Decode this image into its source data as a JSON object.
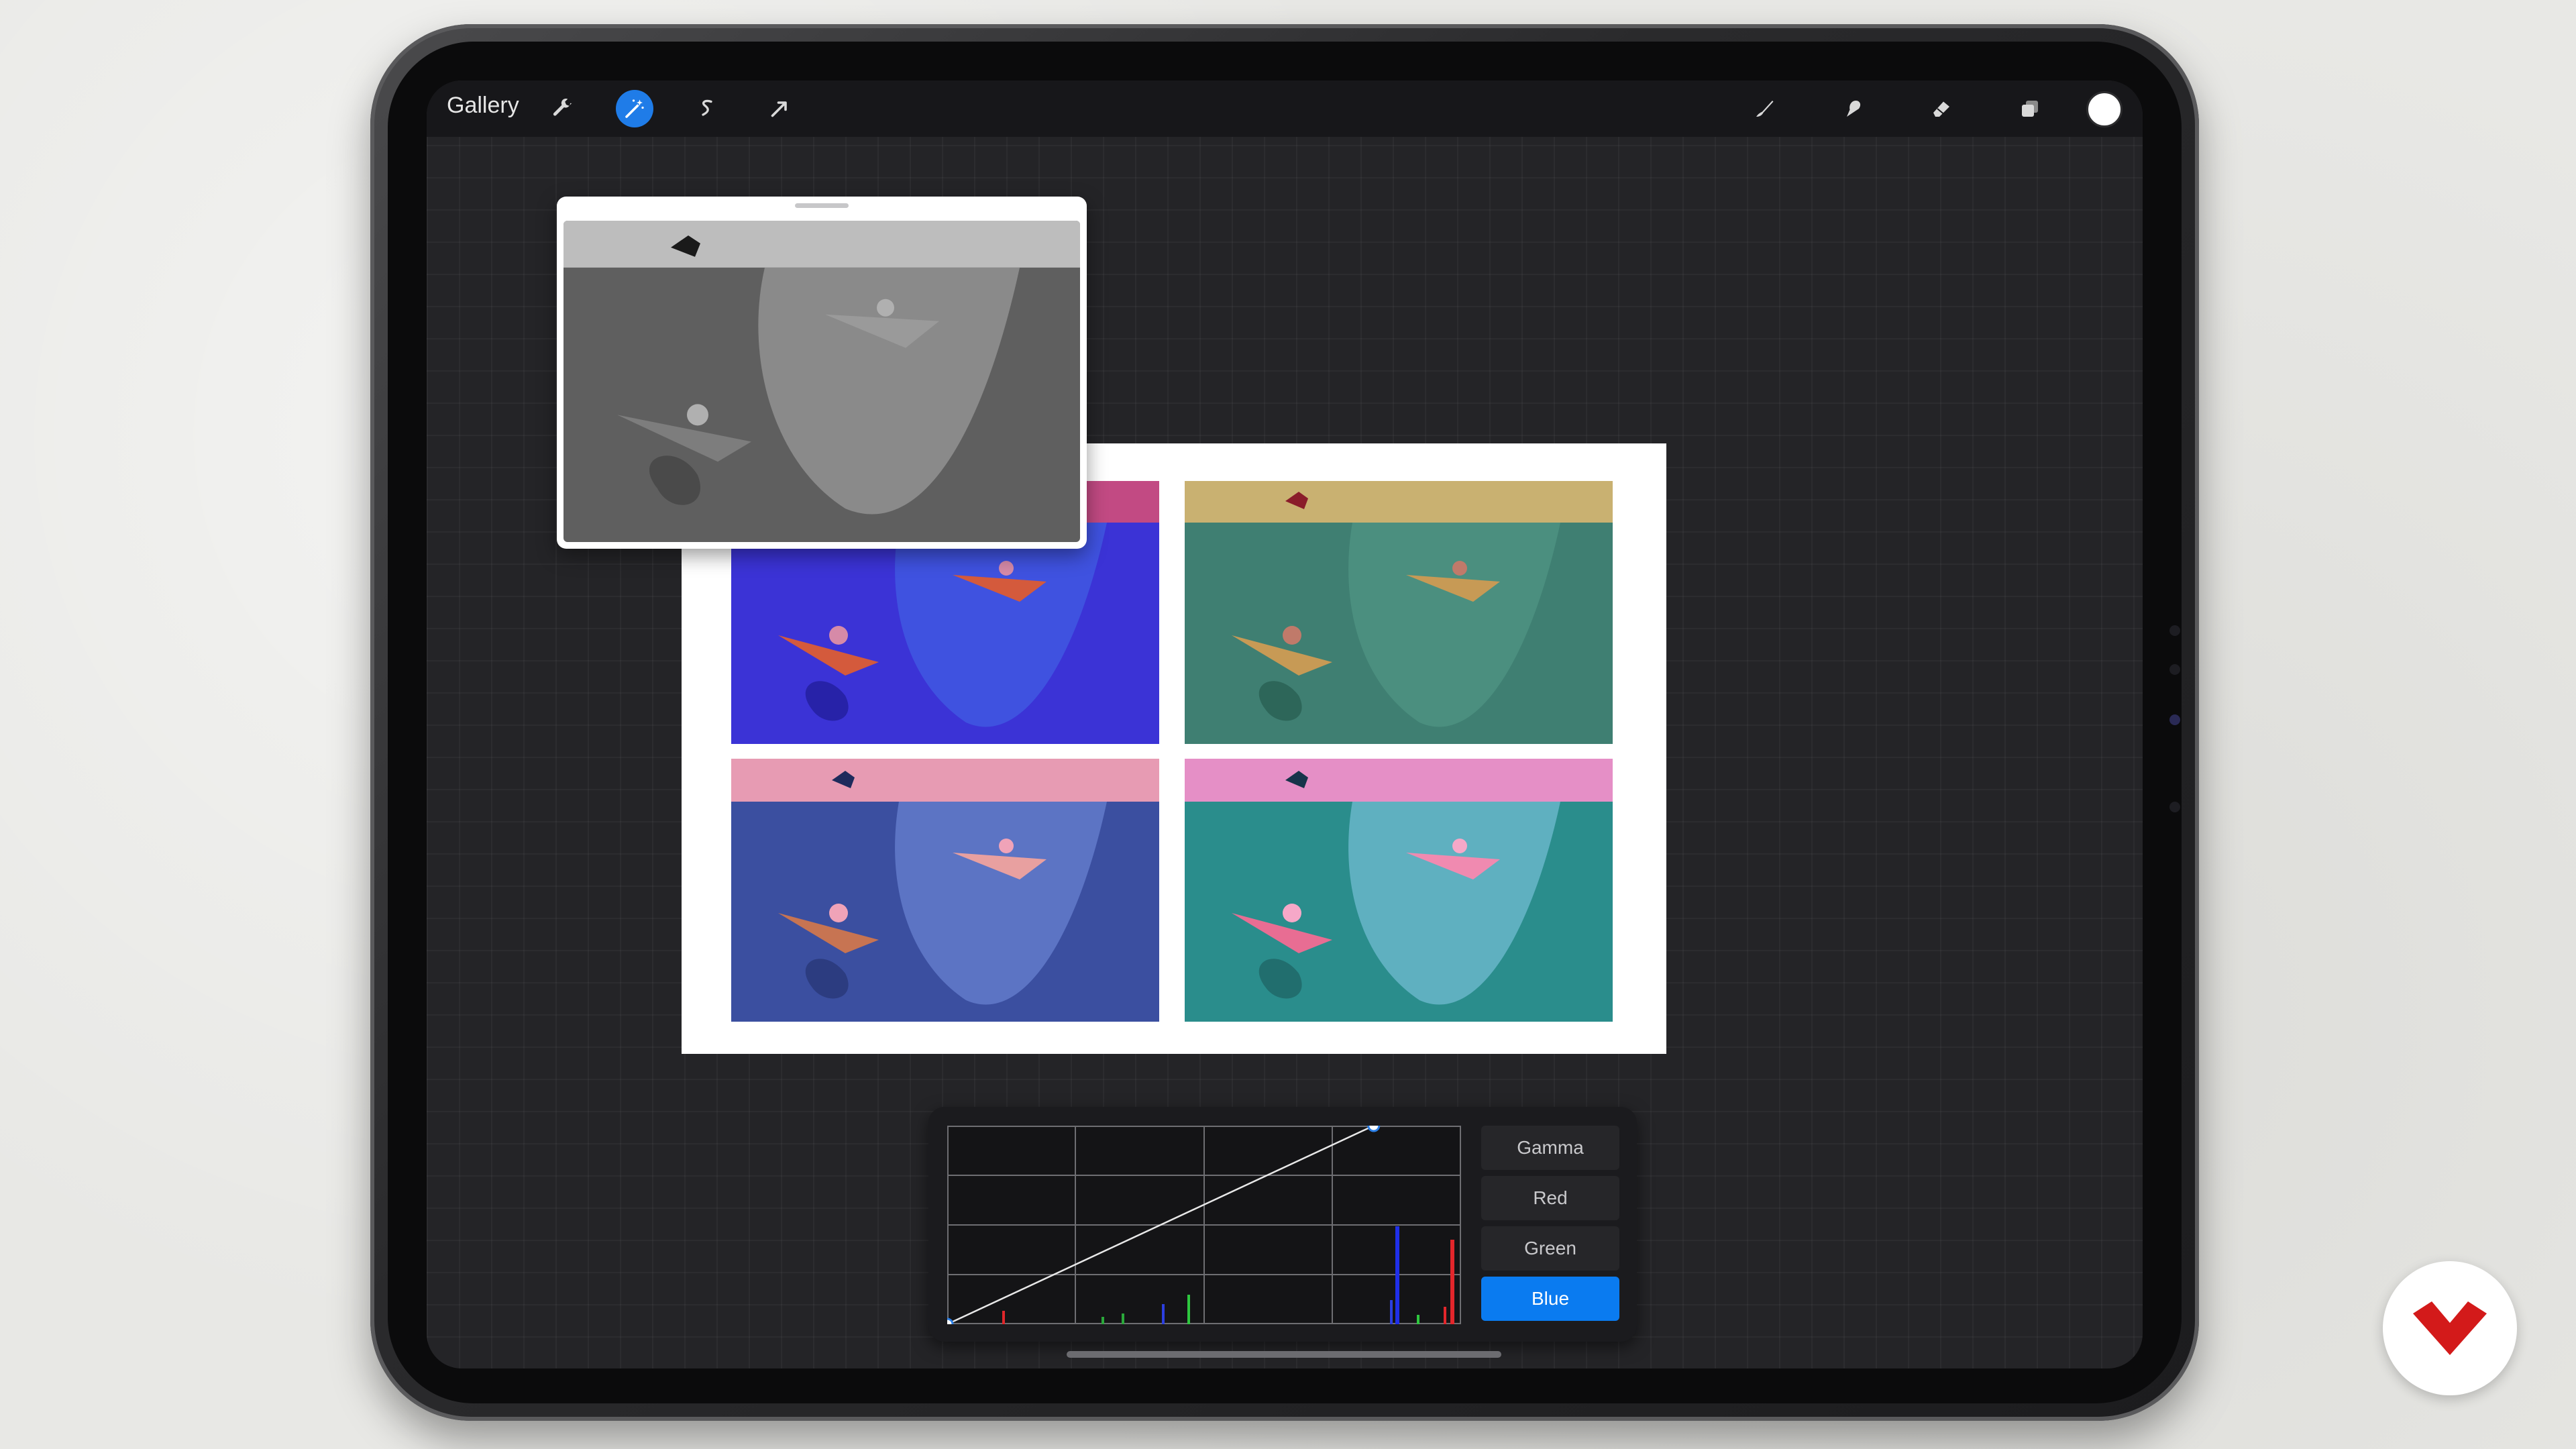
{
  "topbar": {
    "gallery_label": "Gallery",
    "left_tools": [
      {
        "name": "actions",
        "icon": "wrench-icon"
      },
      {
        "name": "adjustments",
        "icon": "magic-wand-icon",
        "active": true
      },
      {
        "name": "selection",
        "icon": "selection-s-icon"
      },
      {
        "name": "transform",
        "icon": "arrow-cursor-icon"
      }
    ],
    "right_tools": [
      {
        "name": "brush",
        "icon": "brush-icon"
      },
      {
        "name": "smudge",
        "icon": "smudge-icon"
      },
      {
        "name": "eraser",
        "icon": "eraser-icon"
      },
      {
        "name": "layers",
        "icon": "layers-icon"
      }
    ],
    "current_color": "#ffffff"
  },
  "artwork": {
    "panels": [
      {
        "id": "top-left",
        "palette": {
          "sky": "#c24a83",
          "water": "#3b33d6",
          "wave": "#3f52e0",
          "boat": "#d45a3c"
        }
      },
      {
        "id": "top-right",
        "palette": {
          "sky": "#c9b171",
          "water": "#3f7f72",
          "wave": "#3a8070",
          "boat": "#c79a55"
        }
      },
      {
        "id": "bottom-left",
        "palette": {
          "sky": "#e79bb3",
          "water": "#3b4fa0",
          "wave": "#5c74c4",
          "boat": "#c77452"
        }
      },
      {
        "id": "bottom-right",
        "palette": {
          "sky": "#e58fc6",
          "water": "#2a8d8c",
          "wave": "#5fb0c0",
          "boat": "#e86d93"
        }
      }
    ]
  },
  "reference_window": {
    "mode": "grayscale",
    "palette": {
      "sky": "#bdbdbd",
      "water": "#5f5f5f",
      "wave": "#8a8a8a",
      "boat": "#7d7d7d"
    }
  },
  "curves": {
    "channels": [
      "Gamma",
      "Red",
      "Green",
      "Blue"
    ],
    "selected_channel": "Blue",
    "curve_points": [
      [
        0,
        0
      ],
      [
        0.83,
        1.0
      ]
    ],
    "accent_color": "#0a7bf0"
  },
  "brand": {
    "logo_icon": "domestika-icon",
    "logo_color": "#d31a1a"
  }
}
